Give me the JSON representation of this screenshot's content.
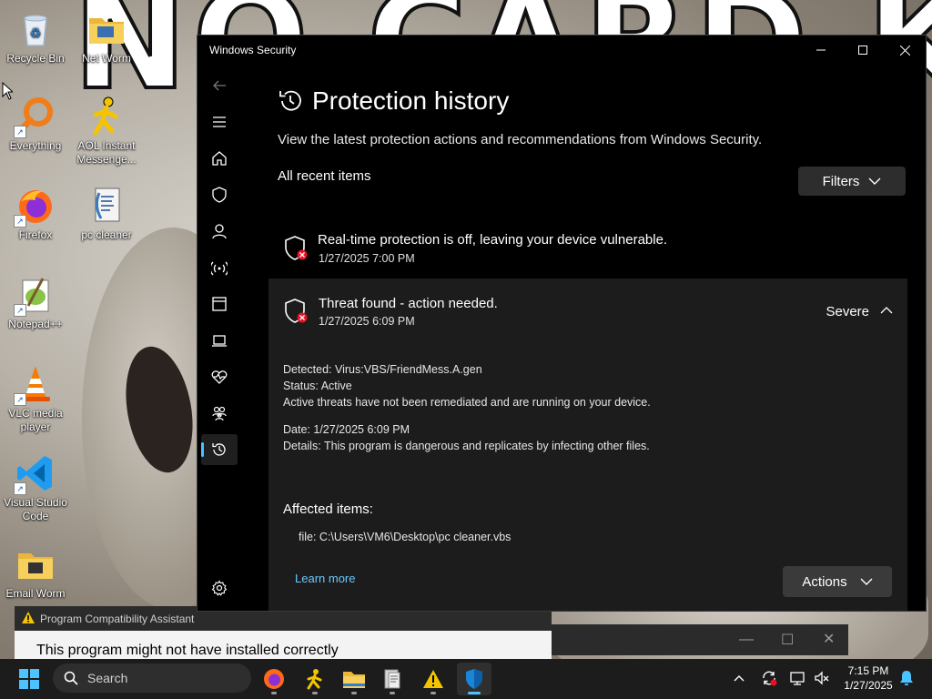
{
  "desktop": {
    "wallpaper_text": "NO CARD KEYS",
    "icons": [
      {
        "label": "Recycle Bin",
        "icon": "recycle-bin-icon"
      },
      {
        "label": "Net Worm",
        "icon": "folder-icon"
      },
      {
        "label": "Everything",
        "icon": "everything-search-icon"
      },
      {
        "label": "AOL Instant Messenge...",
        "icon": "aim-running-man-icon"
      },
      {
        "label": "Firefox",
        "icon": "firefox-icon"
      },
      {
        "label": "pc cleaner",
        "icon": "vbs-script-icon"
      },
      {
        "label": "Notepad++",
        "icon": "notepadpp-icon"
      },
      {
        "label": "VLC media player",
        "icon": "vlc-cone-icon"
      },
      {
        "label": "Visual Studio Code",
        "icon": "vscode-icon"
      },
      {
        "label": "Email Worm",
        "icon": "folder-icon"
      }
    ]
  },
  "window": {
    "title": "Windows Security",
    "page_title": "Protection history",
    "subtitle": "View the latest protection actions and recommendations from Windows Security.",
    "section_label": "All recent items",
    "filters_label": "Filters",
    "items": [
      {
        "title": "Real-time protection is off, leaving your device vulnerable.",
        "date": "1/27/2025 7:00 PM"
      },
      {
        "title": "Threat found - action needed.",
        "date": "1/27/2025 6:09 PM",
        "severity": "Severe",
        "detected_label": "Detected:",
        "detected_value": "Virus:VBS/FriendMess.A.gen",
        "status_label": "Status:",
        "status_value": "Active",
        "status_note": "Active threats have not been remediated and are running on your device.",
        "date_label": "Date:",
        "date_value": "1/27/2025 6:09 PM",
        "details_label": "Details:",
        "details_value": "This program is dangerous and replicates by infecting other files.",
        "affected_label": "Affected items:",
        "affected_file": "file: C:\\Users\\VM6\\Desktop\\pc cleaner.vbs",
        "learn_more": "Learn more",
        "actions_label": "Actions"
      }
    ]
  },
  "pca": {
    "title": "Program Compatibility Assistant",
    "body": "This program might not have installed correctly"
  },
  "taskbar": {
    "search_placeholder": "Search",
    "time": "7:15 PM",
    "date": "1/27/2025"
  },
  "colors": {
    "accent": "#4cc2ff",
    "link": "#6cc8ff",
    "threat_red": "#e81123",
    "window_bg": "#000000",
    "card_bg": "#1c1c1c"
  }
}
